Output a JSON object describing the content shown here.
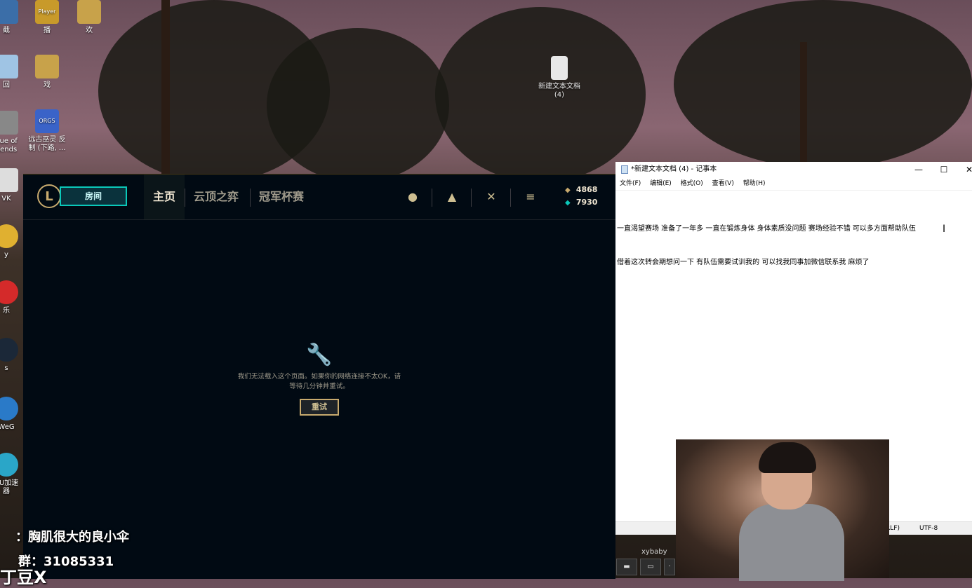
{
  "desktop": {
    "icons": [
      {
        "label": "截",
        "badge": ""
      },
      {
        "label": "播",
        "badge": "Player"
      },
      {
        "label": "欢",
        "badge": ""
      },
      {
        "label": "回",
        "badge": ""
      },
      {
        "label": "戏",
        "badge": ""
      },
      {
        "label": "gue of\ngends",
        "badge": ""
      },
      {
        "label": "远古巫灵 反\n制 (下路, ...",
        "badge": "ORGS"
      },
      {
        "label": "VK",
        "badge": ""
      },
      {
        "label": "y",
        "badge": ""
      },
      {
        "label": "乐",
        "badge": ""
      },
      {
        "label": "s",
        "badge": ""
      },
      {
        "label": "WeG",
        "badge": ""
      },
      {
        "label": "UU加速\n器",
        "badge": ""
      },
      {
        "label": "新建文本文档\n(4)",
        "badge": ""
      }
    ]
  },
  "lol": {
    "logo": "L",
    "play_button": "房间",
    "tabs": [
      "主页",
      "云顶之弈",
      "冠军杯赛"
    ],
    "icons": [
      "profile-icon",
      "collection-icon",
      "loot-icon",
      "store-icon"
    ],
    "currency": {
      "be": "4868",
      "rp": "7930"
    },
    "error": {
      "message": "我们无法载入这个页面。如果你的网络连接不太OK，请\n等待几分钟并重试。",
      "retry": "重试"
    }
  },
  "notepad": {
    "title": "*新建文本文档 (4) - 记事本",
    "menu": [
      "文件(F)",
      "编辑(E)",
      "格式(O)",
      "查看(V)",
      "帮助(H)"
    ],
    "lines": [
      "一直渴望赛场 准备了一年多 一直在锻炼身体 身体素质没问题 赛场经验不错 可以多方面帮助队伍",
      "借着这次转会期想问一下 有队伍需要试训我的 可以找我同事加微信联系我 麻烦了"
    ],
    "status": {
      "eol": "RLF)",
      "encoding": "UTF-8"
    },
    "controls": {
      "min": "—",
      "max": "☐",
      "close": "✕"
    }
  },
  "stream": {
    "name_line": "：胸肌很大的良小伞",
    "group_line": "群：31085331",
    "bottom_partial": "丁豆X",
    "chat_user": "xybaby"
  }
}
